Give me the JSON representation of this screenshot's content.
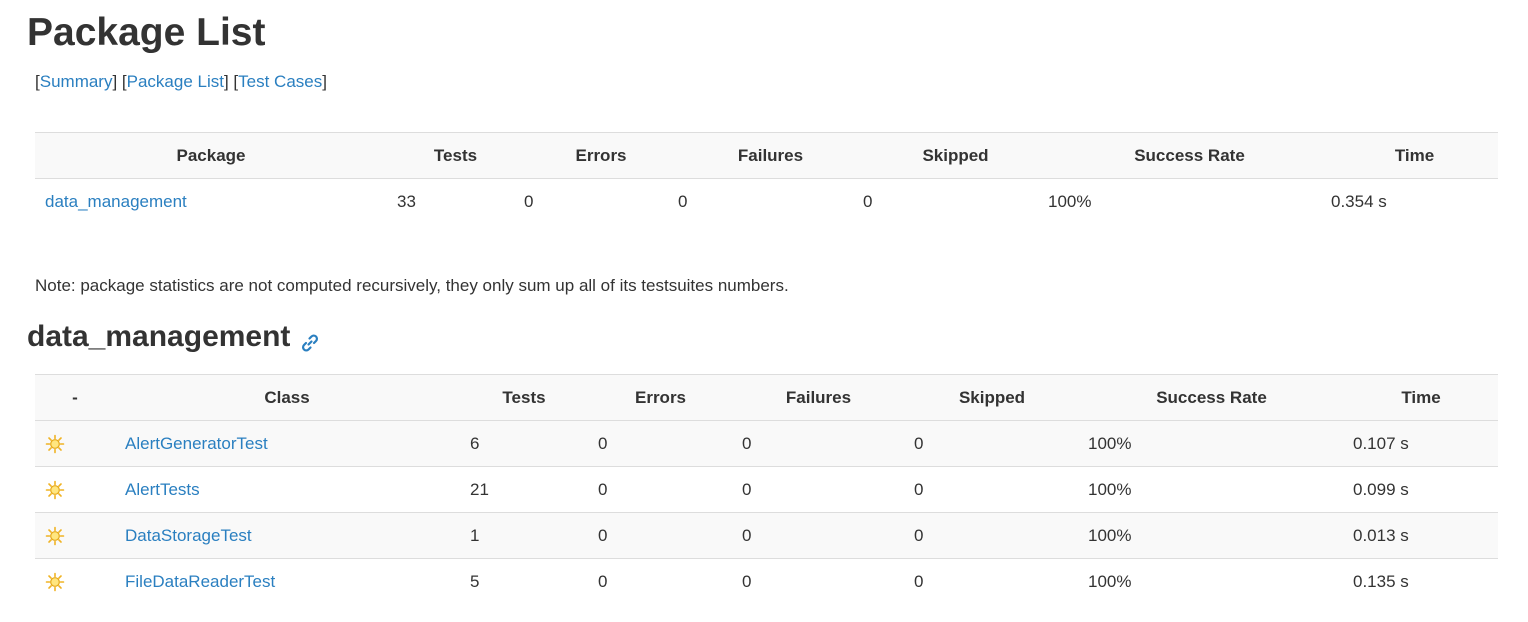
{
  "page_title": "Package List",
  "nav": {
    "summary": "Summary",
    "package_list": "Package List",
    "test_cases": "Test Cases"
  },
  "package_table": {
    "headers": {
      "package": "Package",
      "tests": "Tests",
      "errors": "Errors",
      "failures": "Failures",
      "skipped": "Skipped",
      "success_rate": "Success Rate",
      "time": "Time"
    },
    "rows": [
      {
        "package": "data_management",
        "tests": "33",
        "errors": "0",
        "failures": "0",
        "skipped": "0",
        "success_rate": "100%",
        "time": "0.354 s"
      }
    ]
  },
  "note": "Note: package statistics are not computed recursively, they only sum up all of its testsuites numbers.",
  "section": {
    "title": "data_management",
    "anchor_icon": "link-icon"
  },
  "class_table": {
    "headers": {
      "status": "-",
      "class": "Class",
      "tests": "Tests",
      "errors": "Errors",
      "failures": "Failures",
      "skipped": "Skipped",
      "success_rate": "Success Rate",
      "time": "Time"
    },
    "status_icon": "sun-success-icon",
    "rows": [
      {
        "class": "AlertGeneratorTest",
        "tests": "6",
        "errors": "0",
        "failures": "0",
        "skipped": "0",
        "success_rate": "100%",
        "time": "0.107 s"
      },
      {
        "class": "AlertTests",
        "tests": "21",
        "errors": "0",
        "failures": "0",
        "skipped": "0",
        "success_rate": "100%",
        "time": "0.099 s"
      },
      {
        "class": "DataStorageTest",
        "tests": "1",
        "errors": "0",
        "failures": "0",
        "skipped": "0",
        "success_rate": "100%",
        "time": "0.013 s"
      },
      {
        "class": "FileDataReaderTest",
        "tests": "5",
        "errors": "0",
        "failures": "0",
        "skipped": "0",
        "success_rate": "100%",
        "time": "0.135 s"
      }
    ]
  },
  "colors": {
    "link": "#2a7fc0",
    "header_bg": "#f9f9f9",
    "border": "#dddddd",
    "text": "#333333"
  }
}
